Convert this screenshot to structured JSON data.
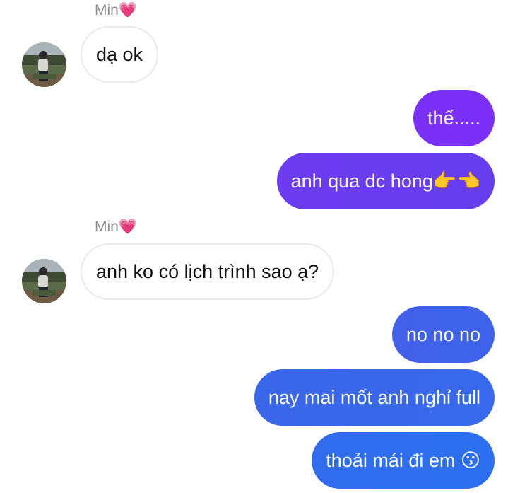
{
  "conversation": {
    "messages": [
      {
        "sender": "Min💗",
        "text": "dạ ok",
        "direction": "incoming"
      },
      {
        "text": "thế.....",
        "direction": "outgoing",
        "color": "#7b2ff7"
      },
      {
        "text": "anh qua dc hong👉👈",
        "direction": "outgoing",
        "color": "#6a3ef0"
      },
      {
        "sender": "Min💗",
        "text": "anh ko có lịch trình sao ạ?",
        "direction": "incoming"
      },
      {
        "text": "no no no",
        "direction": "outgoing",
        "color": "#3d63ea"
      },
      {
        "text": "nay mai mốt anh nghỉ full",
        "direction": "outgoing",
        "color": "#3a65ea"
      },
      {
        "text": "thoải mái đi em 😗",
        "direction": "outgoing",
        "color": "#2c6ff0"
      }
    ]
  }
}
